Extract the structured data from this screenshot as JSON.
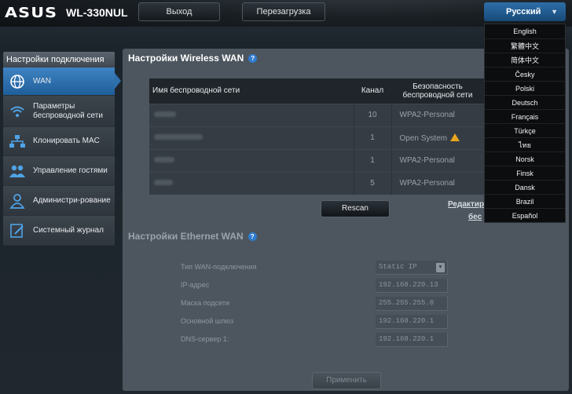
{
  "header": {
    "brand": "ASUS",
    "model": "WL-330NUL",
    "logout_label": "Выход",
    "reboot_label": "Перезагрузка",
    "language_label": "Русский"
  },
  "languages": [
    "English",
    "繁體中文",
    "简体中文",
    "Česky",
    "Polski",
    "Deutsch",
    "Français",
    "Türkçe",
    "ไทย",
    "Norsk",
    "Finsk",
    "Dansk",
    "Brazil",
    "Español"
  ],
  "sidebar": {
    "heading": "Настройки подключения",
    "items": [
      {
        "label": "WAN",
        "icon": "globe-icon"
      },
      {
        "label": "Параметры беспроводной сети",
        "icon": "wifi-icon"
      },
      {
        "label": "Клонировать MAC",
        "icon": "network-icon"
      },
      {
        "label": "Управление гостями",
        "icon": "users-icon"
      },
      {
        "label": "Администри-рование",
        "icon": "admin-user-icon"
      },
      {
        "label": "Системный журнал",
        "icon": "log-icon"
      }
    ]
  },
  "wireless": {
    "title": "Настройки Wireless WAN",
    "columns": {
      "ssid": "Имя беспроводной сети",
      "channel": "Канал",
      "security": "Безопасность беспроводной сети"
    },
    "rows": [
      {
        "channel": "10",
        "security": "WPA2-Personal"
      },
      {
        "channel": "1",
        "security": "Open System"
      },
      {
        "channel": "1",
        "security": "WPA2-Personal"
      },
      {
        "channel": "5",
        "security": "WPA2-Personal"
      }
    ],
    "rescan_label": "Rescan",
    "link1": "Редактир",
    "link2": "бес"
  },
  "ethernet": {
    "title": "Настройки Ethernet WAN",
    "fields": [
      {
        "label": "Тип WAN-подключения",
        "value": "Static IP"
      },
      {
        "label": "IP-адрес",
        "value": "192.168.220.13"
      },
      {
        "label": "Маска подсети",
        "value": "255.255.255.0"
      },
      {
        "label": "Основной шлюз",
        "value": "192.168.220.1"
      },
      {
        "label": "DNS-сервер 1:",
        "value": "192.168.220.1"
      }
    ],
    "apply_label": "Применить"
  }
}
